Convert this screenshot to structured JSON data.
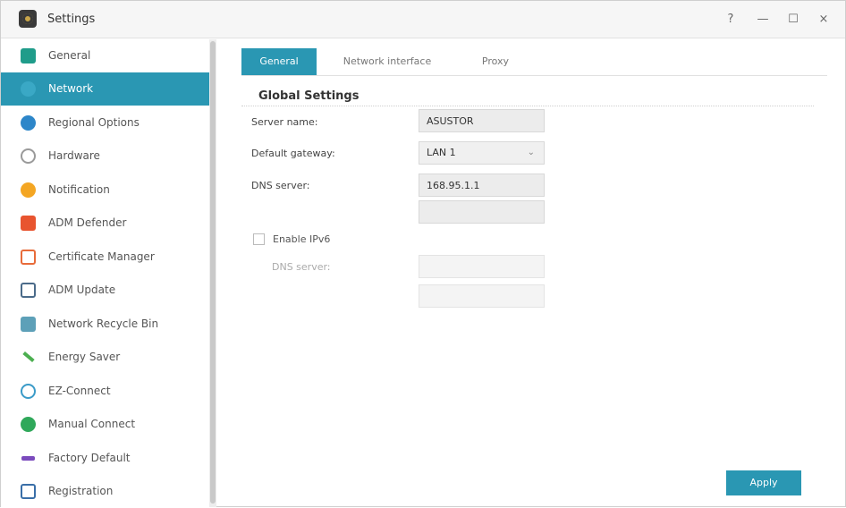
{
  "window": {
    "title": "Settings",
    "controls": {
      "help": "?",
      "minimize": "—",
      "maximize": "☐",
      "close": "×"
    }
  },
  "sidebar": {
    "items": [
      {
        "label": "General",
        "icon": "general-icon"
      },
      {
        "label": "Network",
        "icon": "network-icon",
        "active": true
      },
      {
        "label": "Regional Options",
        "icon": "regional-icon"
      },
      {
        "label": "Hardware",
        "icon": "hardware-icon"
      },
      {
        "label": "Notification",
        "icon": "notification-icon"
      },
      {
        "label": "ADM Defender",
        "icon": "defender-icon"
      },
      {
        "label": "Certificate Manager",
        "icon": "certificate-icon"
      },
      {
        "label": "ADM Update",
        "icon": "update-icon"
      },
      {
        "label": "Network Recycle Bin",
        "icon": "recycle-bin-icon"
      },
      {
        "label": "Energy Saver",
        "icon": "energy-icon"
      },
      {
        "label": "EZ-Connect",
        "icon": "cloud-icon"
      },
      {
        "label": "Manual Connect",
        "icon": "globe-icon"
      },
      {
        "label": "Factory Default",
        "icon": "undo-icon"
      },
      {
        "label": "Registration",
        "icon": "registration-icon"
      }
    ]
  },
  "tabs": [
    {
      "label": "General",
      "active": true
    },
    {
      "label": "Network interface"
    },
    {
      "label": "Proxy"
    }
  ],
  "global": {
    "title": "Global Settings",
    "server_name_label": "Server name:",
    "server_name_value": "ASUSTOR",
    "gateway_label": "Default gateway:",
    "gateway_value": "LAN 1",
    "dns_label": "DNS server:",
    "dns_value_1": "168.95.1.1",
    "dns_value_2": "",
    "ipv6_label": "Enable IPv6",
    "ipv6_checked": false,
    "ipv6_dns_label": "DNS server:",
    "ipv6_dns_value_1": "",
    "ipv6_dns_value_2": ""
  },
  "actions": {
    "apply_label": "Apply"
  },
  "colors": {
    "accent": "#2a97b3"
  }
}
